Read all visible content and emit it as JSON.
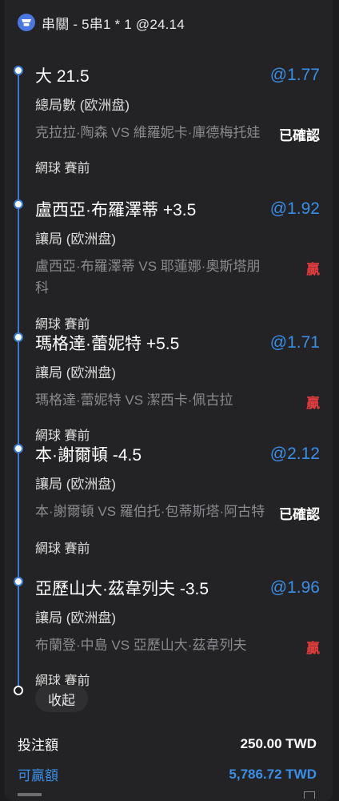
{
  "header": {
    "title": "串關 - 5串1 * 1 @24.14",
    "icon": "parlay-icon"
  },
  "selections": [
    {
      "name": "大 21.5",
      "odds": "@1.77",
      "market": "總局數 (欧洲盘)",
      "match": "克拉拉·陶森 VS 維羅妮卡·庫德梅托娃",
      "status": "已確認",
      "sport": "網球 賽前"
    },
    {
      "name": "盧西亞·布羅澤蒂 +3.5",
      "odds": "@1.92",
      "market": "讓局 (欧洲盘)",
      "match": "盧西亞·布羅澤蒂 VS 耶蓮娜·奧斯塔朋科",
      "status": "贏",
      "sport": "網球 賽前"
    },
    {
      "name": "瑪格達·蕾妮特 +5.5",
      "odds": "@1.71",
      "market": "讓局 (欧洲盘)",
      "match": "瑪格達·蕾妮特 VS 潔西卡·佩古拉",
      "status": "贏",
      "sport": "網球 賽前"
    },
    {
      "name": "本·謝爾頓 -4.5",
      "odds": "@2.12",
      "market": "讓局 (欧洲盘)",
      "match": "本·謝爾頓 VS 羅伯托·包蒂斯塔·阿古特",
      "status": "已確認",
      "sport": "網球 賽前"
    },
    {
      "name": "亞歷山大·茲韋列夫 -3.5",
      "odds": "@1.96",
      "market": "讓局 (欧洲盘)",
      "match": "布蘭登·中島 VS 亞歷山大·茲韋列夫",
      "status": "贏",
      "sport": "網球 賽前"
    }
  ],
  "collapse_label": "收起",
  "summary": {
    "stake_label": "投注額",
    "stake_value": "250.00 TWD",
    "win_label": "可贏額",
    "win_value": "5,786.72 TWD"
  },
  "colors": {
    "accent": "#3a8ee6",
    "timeline": "#3a7bd5",
    "won": "#e03c3c",
    "background": "#1c1c1e"
  }
}
